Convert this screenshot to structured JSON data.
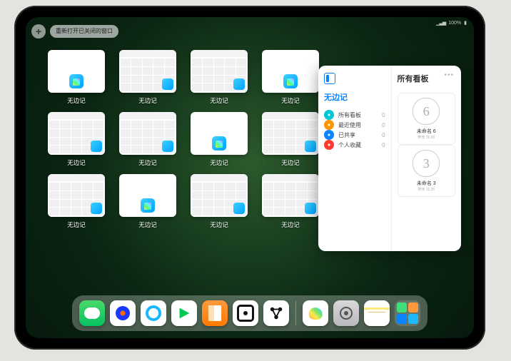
{
  "status": {
    "battery": "100%"
  },
  "top": {
    "plus": "+",
    "reopen_label": "重新打开已关闭的窗口"
  },
  "tile_label": "无边记",
  "grid": [
    {
      "kind": "blank"
    },
    {
      "kind": "cal"
    },
    {
      "kind": "cal"
    },
    {
      "kind": "blank"
    },
    {
      "kind": "cal"
    },
    {
      "kind": "cal"
    },
    {
      "kind": "blank"
    },
    {
      "kind": "cal"
    },
    {
      "kind": "cal"
    },
    {
      "kind": "blank"
    },
    {
      "kind": "cal"
    },
    {
      "kind": "cal"
    }
  ],
  "sidebar": {
    "left_title": "无边记",
    "items": [
      {
        "label": "所有看板",
        "count": "0",
        "color": "cyan"
      },
      {
        "label": "最近使用",
        "count": "0",
        "color": "orange"
      },
      {
        "label": "已共享",
        "count": "0",
        "color": "blue"
      },
      {
        "label": "个人收藏",
        "count": "0",
        "color": "red"
      }
    ],
    "right_title": "所有看板",
    "boards": [
      {
        "glyph": "6",
        "name": "未命名 6",
        "time": "昨天 11:26"
      },
      {
        "glyph": "3",
        "name": "未命名 3",
        "time": "昨天 11:25"
      }
    ]
  },
  "dock": {
    "apps": [
      {
        "name": "wechat"
      },
      {
        "name": "tencent-video"
      },
      {
        "name": "quark"
      },
      {
        "name": "iqiyi"
      },
      {
        "name": "books"
      },
      {
        "name": "obsidian-like"
      },
      {
        "name": "xmind-like"
      }
    ],
    "recent": [
      {
        "name": "freeform"
      },
      {
        "name": "settings"
      },
      {
        "name": "notes"
      }
    ],
    "library_colors": [
      "#3fe07a",
      "#ff9a3c",
      "#0a84ff",
      "#1fb8ff"
    ]
  }
}
